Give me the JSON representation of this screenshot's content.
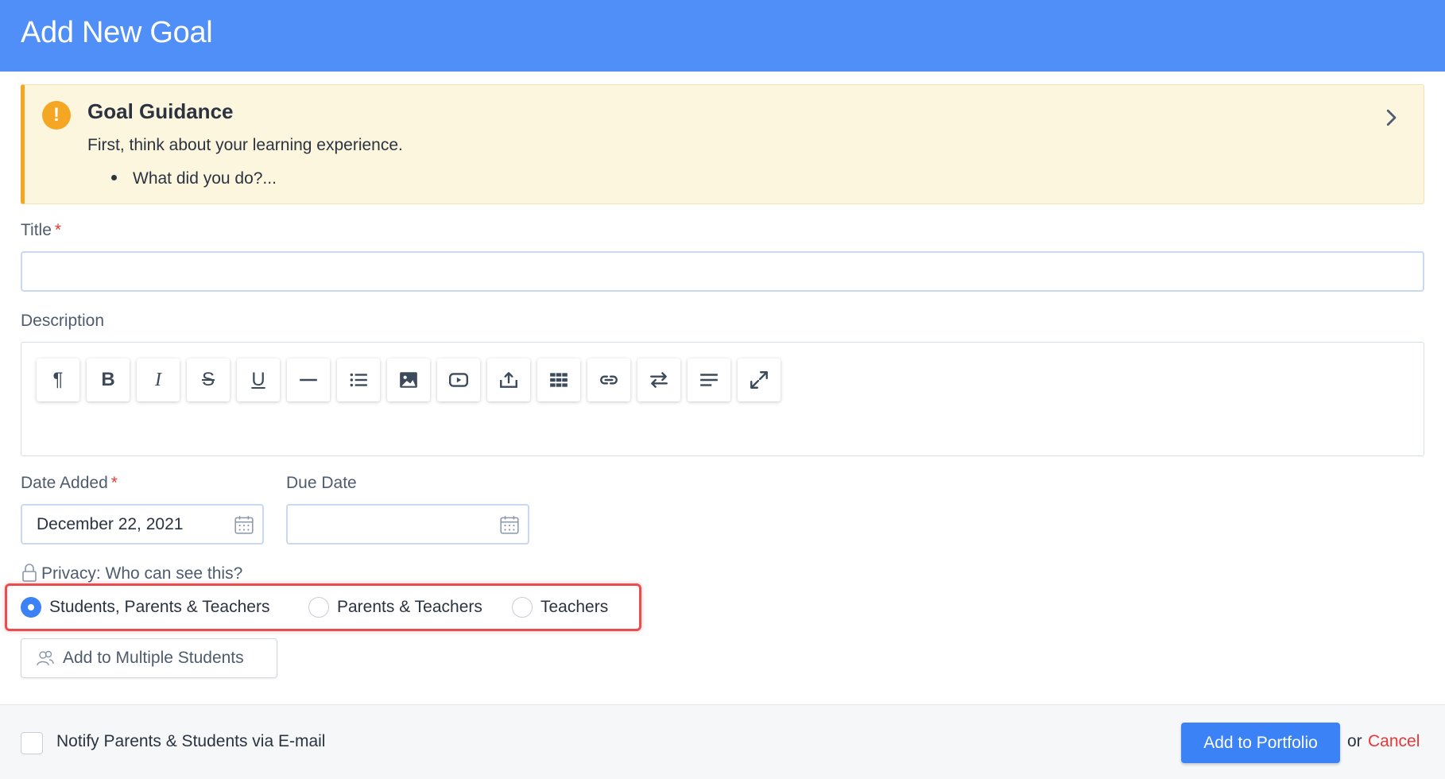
{
  "header": {
    "title": "Add New Goal",
    "color": "#4f8ff7"
  },
  "guidance": {
    "icon": "alert-icon",
    "title": "Goal Guidance",
    "text": "First, think about your learning experience.",
    "bullet": "What did you do?...",
    "expand_icon": "chevron-right-icon"
  },
  "title_field": {
    "label": "Title",
    "required_mark": "*",
    "value": ""
  },
  "description": {
    "label": "Description",
    "toolbar": [
      "paragraph-icon",
      "bold-icon",
      "italic-icon",
      "strikethrough-icon",
      "underline-icon",
      "horizontal-rule-icon",
      "list-icon",
      "image-icon",
      "video-icon",
      "upload-icon",
      "table-icon",
      "link-icon",
      "swap-icon",
      "align-icon",
      "fullscreen-icon"
    ],
    "toolbar_text": {
      "paragraph": "¶",
      "bold": "B",
      "italic": "I",
      "strike": "S",
      "underline": "U"
    }
  },
  "date_added": {
    "label": "Date Added",
    "required_mark": "*",
    "value": "December 22, 2021"
  },
  "due_date": {
    "label": "Due Date",
    "value": ""
  },
  "privacy": {
    "label": "Privacy: Who can see this?",
    "options": [
      {
        "label": "Students, Parents & Teachers",
        "checked": true
      },
      {
        "label": "Parents & Teachers",
        "checked": false
      },
      {
        "label": "Teachers",
        "checked": false
      }
    ],
    "highlight_color": "#e94d4d"
  },
  "multi_students_button": "Add to Multiple Students",
  "footer": {
    "notify_label": "Notify Parents & Students via E-mail",
    "notify_checked": false,
    "submit_label": "Add to Portfolio",
    "or_text": "or",
    "cancel_label": "Cancel",
    "accent": "#3b82f6",
    "cancel_color": "#e53935"
  }
}
